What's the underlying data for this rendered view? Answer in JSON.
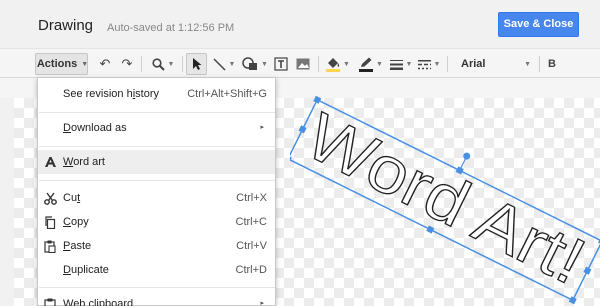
{
  "app": {
    "title": "Drawing",
    "autosave": "Auto-saved at 1:12:56 PM",
    "save_close_label": "Save & Close"
  },
  "toolbar": {
    "actions_label": "Actions",
    "font_name": "Arial",
    "bold_label": "B",
    "fill_color": "#ffd54f",
    "line_color": "#222222"
  },
  "menu": {
    "items": [
      {
        "label": "See revision history",
        "shortcut": "Ctrl+Alt+Shift+G"
      },
      {
        "label": "Download as",
        "submenu": "▸"
      },
      {
        "label": "Word art"
      },
      {
        "label": "Cut",
        "shortcut": "Ctrl+X"
      },
      {
        "label": "Copy",
        "shortcut": "Ctrl+C"
      },
      {
        "label": "Paste",
        "shortcut": "Ctrl+V"
      },
      {
        "label": "Duplicate",
        "shortcut": "Ctrl+D"
      },
      {
        "label": "Web clipboard",
        "submenu": "▸"
      }
    ]
  },
  "canvas": {
    "wordart_text": "Word Art!",
    "selection_color": "#4a90e2"
  }
}
